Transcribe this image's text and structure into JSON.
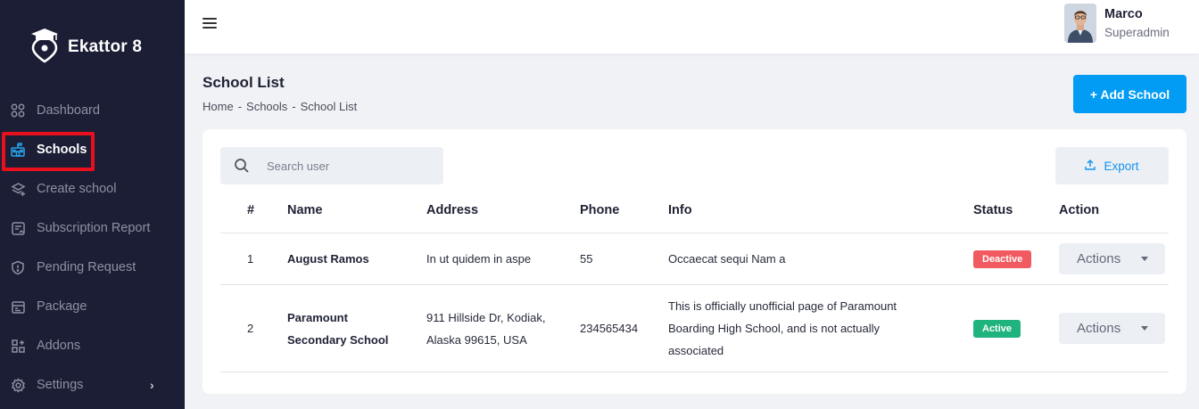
{
  "brand": {
    "name": "Ekattor 8"
  },
  "sidebar": {
    "items": [
      {
        "label": "Dashboard",
        "icon": "grid-icon"
      },
      {
        "label": "Schools",
        "icon": "school-icon"
      },
      {
        "label": "Create school",
        "icon": "layers-icon"
      },
      {
        "label": "Subscription Report",
        "icon": "report-icon"
      },
      {
        "label": "Pending Request",
        "icon": "shield-icon"
      },
      {
        "label": "Package",
        "icon": "package-icon"
      },
      {
        "label": "Addons",
        "icon": "addons-icon"
      },
      {
        "label": "Settings",
        "icon": "gear-icon"
      }
    ],
    "active_index": 1
  },
  "user": {
    "name": "Marco",
    "role": "Superadmin"
  },
  "page": {
    "title": "School List",
    "breadcrumb": [
      "Home",
      "-",
      "Schools",
      "-",
      "School List"
    ],
    "add_button": "+ Add School"
  },
  "search": {
    "placeholder": "Search user",
    "value": ""
  },
  "export_label": "Export",
  "table": {
    "headers": [
      "#",
      "Name",
      "Address",
      "Phone",
      "Info",
      "Status",
      "Action"
    ],
    "rows": [
      {
        "num": "1",
        "name": "August Ramos",
        "address": "In ut quidem in aspe",
        "phone": "55",
        "info": "Occaecat sequi Nam a",
        "status": "Deactive",
        "action": "Actions"
      },
      {
        "num": "2",
        "name_line1": "Paramount",
        "name_line2": "Secondary School",
        "address_line1": "911 Hillside Dr, Kodiak,",
        "address_line2": "Alaska 99615, USA",
        "phone": "234565434",
        "info_line1": "This is officially unofficial page of Paramount",
        "info_line2": "Boarding High School, and is not actually",
        "info_line3": "associated",
        "status": "Active",
        "action": "Actions"
      }
    ]
  },
  "colors": {
    "sidebar_bg": "#1b1e35",
    "accent": "#039cf4",
    "highlight": "#e8101d",
    "deactive": "#f15a60",
    "active": "#1fb37d"
  }
}
